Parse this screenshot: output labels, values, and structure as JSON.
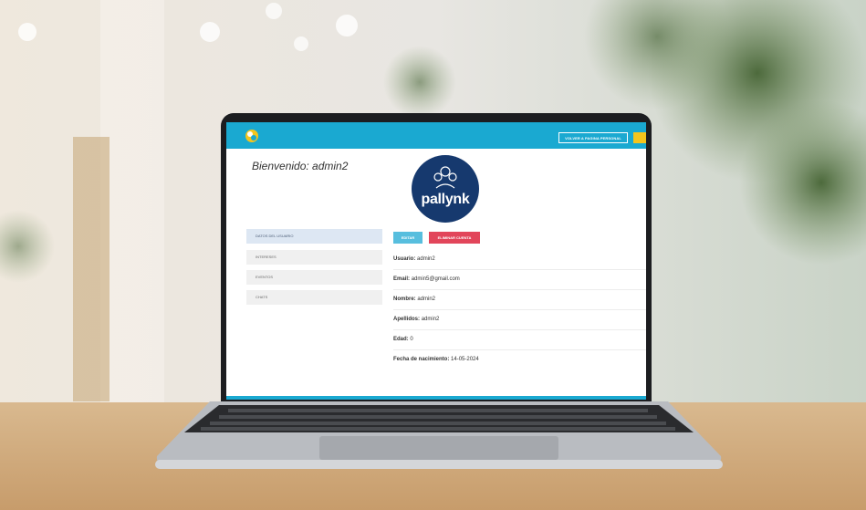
{
  "header": {
    "back_button_label": "VOLVER A PAGINA PERSONAL"
  },
  "welcome_text": "Bienvenido: admin2",
  "brand": {
    "logo_text": "pallynk"
  },
  "sidebar": {
    "items": [
      {
        "label": "DATOS DEL USUARIO"
      },
      {
        "label": "INTERESES"
      },
      {
        "label": "EVENTOS"
      },
      {
        "label": "CHATS"
      }
    ]
  },
  "actions": {
    "edit_label": "EDITAR",
    "delete_label": "ELIMINAR CUENTA"
  },
  "user": {
    "fields": [
      {
        "label": "Usuario:",
        "value": "admin2"
      },
      {
        "label": "Email:",
        "value": "admin5@gmail.com"
      },
      {
        "label": "Nombre:",
        "value": "admin2"
      },
      {
        "label": "Apellidos:",
        "value": "admin2"
      },
      {
        "label": "Edad:",
        "value": "0"
      },
      {
        "label": "Fecha de nacimiento:",
        "value": "14-05-2024"
      }
    ]
  },
  "colors": {
    "topbar": "#1aa9d1",
    "edit_button": "#57bede",
    "delete_button": "#e2455a",
    "avatar_bg": "#16396e"
  }
}
